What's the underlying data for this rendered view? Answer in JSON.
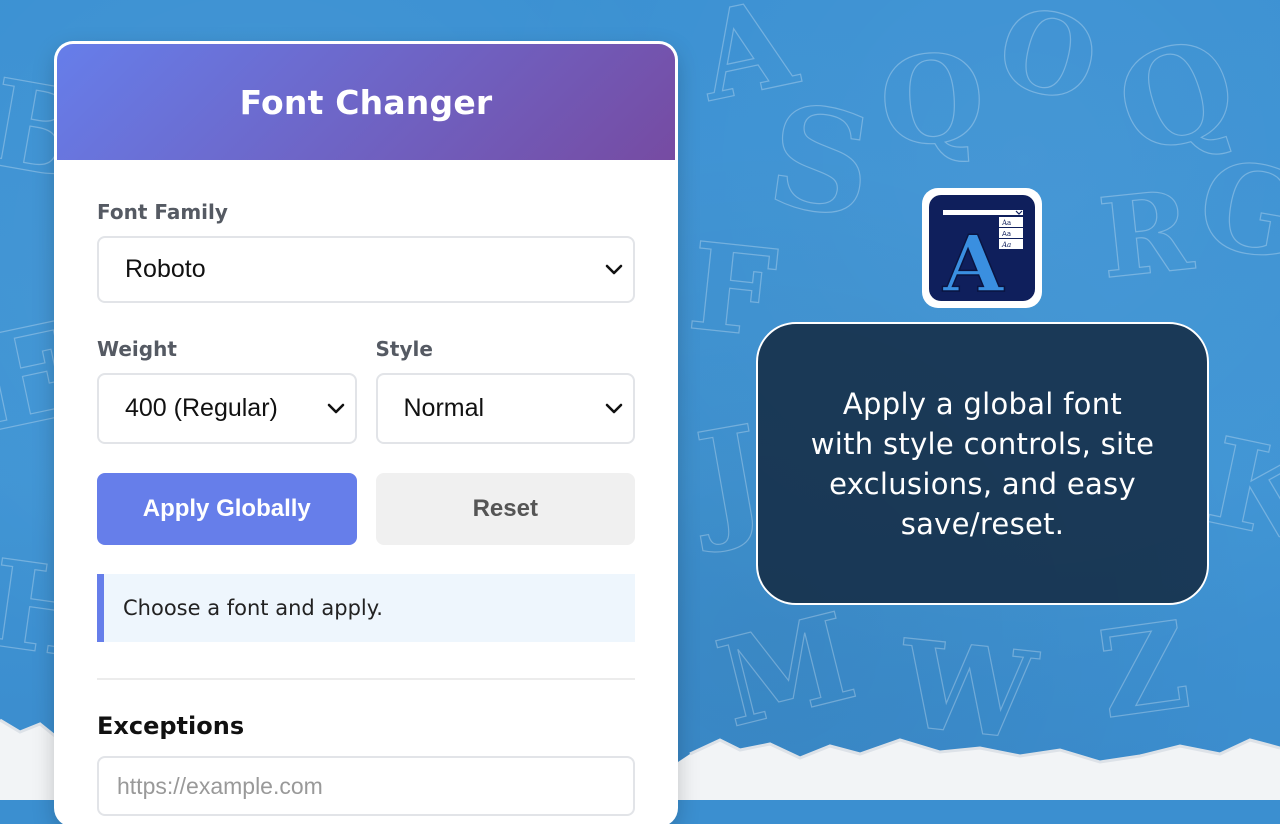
{
  "popup": {
    "title": "Font Changer",
    "font_family": {
      "label": "Font Family",
      "selected": "Roboto"
    },
    "weight": {
      "label": "Weight",
      "selected": "400 (Regular)"
    },
    "style": {
      "label": "Style",
      "selected": "Normal"
    },
    "buttons": {
      "apply": "Apply Globally",
      "reset": "Reset"
    },
    "status_message": "Choose a font and apply.",
    "exceptions": {
      "title": "Exceptions",
      "placeholder": "https://example.com"
    }
  },
  "promo": {
    "text": "Apply a global font with style controls, site exclusions, and easy save/reset."
  },
  "colors": {
    "header_gradient_start": "#667eea",
    "header_gradient_end": "#764ba2",
    "primary_button": "#667eea",
    "status_accent": "#667eea",
    "background": "#3b8fd0",
    "promo_box": "#142c46"
  },
  "icons": {
    "logo": "font-changer-logo-icon",
    "dropdown": "chevron-down-icon"
  }
}
